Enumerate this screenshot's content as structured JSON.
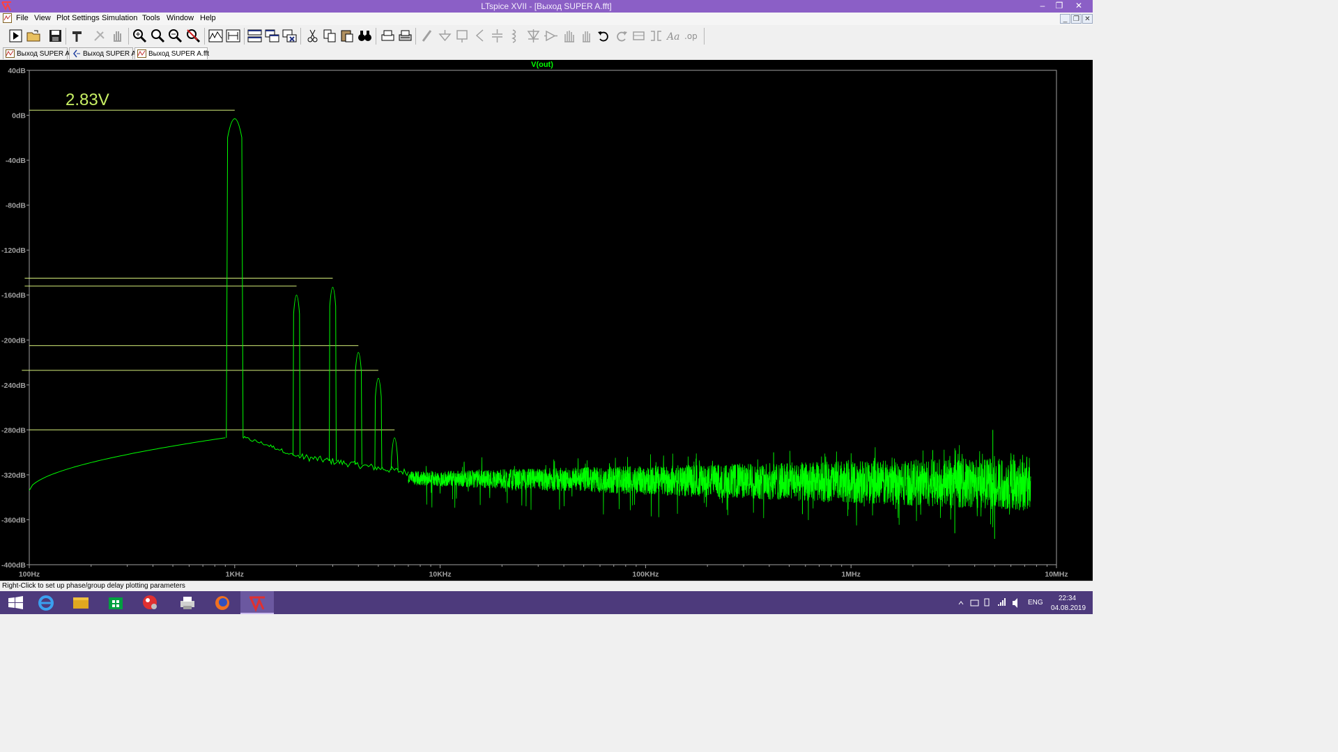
{
  "window": {
    "title": "LTspice XVII - [Выход SUPER A.fft]"
  },
  "menu": [
    "File",
    "View",
    "Plot Settings",
    "Simulation",
    "Tools",
    "Window",
    "Help"
  ],
  "toolbar_icons": [
    "run-icon",
    "open-icon",
    "save-icon",
    "hammer-icon",
    "probe-icon",
    "pan-hand-icon",
    "zoom-in-icon",
    "zoom-area-icon",
    "zoom-out-icon",
    "zoom-cancel-icon",
    "tile-plots-icon",
    "fit-plot-icon",
    "tile-horizontal-icon",
    "cascade-icon",
    "close-all-icon",
    "cut-icon",
    "copy-icon",
    "paste-icon",
    "find-icon",
    "print-icon",
    "print-setup-icon",
    "wire-icon",
    "ground-icon",
    "label-icon",
    "resistor-icon",
    "capacitor-icon",
    "inductor-icon",
    "diode-icon",
    "component-icon",
    "move-icon",
    "drag-icon",
    "undo-icon",
    "redo-icon",
    "rotate-icon",
    "mirror-icon",
    "text-icon",
    "spice-directive-icon"
  ],
  "tabs": [
    {
      "label": "Выход SUPER A",
      "icon": "waveform-icon",
      "active": false
    },
    {
      "label": "Выход SUPER A",
      "icon": "schematic-icon",
      "active": false
    },
    {
      "label": "Выход SUPER A.fft",
      "icon": "waveform-icon",
      "active": true
    }
  ],
  "chart_data": {
    "type": "line",
    "title": "V(out)",
    "annotation": "2.83V",
    "x_scale": "log",
    "xlim": [
      100,
      10000000
    ],
    "ylim": [
      -400,
      40
    ],
    "xticks": [
      {
        "value": 100,
        "label": "100Hz"
      },
      {
        "value": 1000,
        "label": "1KHz"
      },
      {
        "value": 10000,
        "label": "10KHz"
      },
      {
        "value": 100000,
        "label": "100KHz"
      },
      {
        "value": 1000000,
        "label": "1MHz"
      },
      {
        "value": 10000000,
        "label": "10MHz"
      }
    ],
    "yticks": [
      {
        "value": 40,
        "label": "40dB"
      },
      {
        "value": 0,
        "label": "0dB"
      },
      {
        "value": -40,
        "label": "-40dB"
      },
      {
        "value": -80,
        "label": "-80dB"
      },
      {
        "value": -120,
        "label": "-120dB"
      },
      {
        "value": -160,
        "label": "-160dB"
      },
      {
        "value": -200,
        "label": "-200dB"
      },
      {
        "value": -240,
        "label": "-240dB"
      },
      {
        "value": -280,
        "label": "-280dB"
      },
      {
        "value": -320,
        "label": "-320dB"
      },
      {
        "value": -360,
        "label": "-360dB"
      },
      {
        "value": -400,
        "label": "-400dB"
      }
    ],
    "harmonics": [
      {
        "freq": 1000,
        "db": 5
      },
      {
        "freq": 2000,
        "db": -152
      },
      {
        "freq": 3000,
        "db": -145
      },
      {
        "freq": 4000,
        "db": -203
      },
      {
        "freq": 5000,
        "db": -226
      },
      {
        "freq": 6000,
        "db": -279
      }
    ],
    "marker_lines": [
      {
        "db": 4.5,
        "x_from": 100,
        "x_to": 1000
      },
      {
        "db": -145,
        "x_from": 95,
        "x_to": 3000
      },
      {
        "db": -152,
        "x_from": 95,
        "x_to": 2000
      },
      {
        "db": -205,
        "x_from": 100,
        "x_to": 4000
      },
      {
        "db": -227,
        "x_from": 92,
        "x_to": 5000
      },
      {
        "db": -280,
        "x_from": 100,
        "x_to": 6000
      }
    ],
    "floor": {
      "start": [
        100,
        -334
      ],
      "near_fundamental": [
        900,
        -287
      ],
      "after_fundamental": [
        1100,
        -287
      ],
      "at_2k": [
        1950,
        -303
      ],
      "at_10k": [
        10000,
        -322
      ],
      "at_100k": [
        100000,
        -327
      ],
      "at_1M": [
        1000000,
        -329
      ],
      "end_freq": 7500000,
      "end_db": -320
    },
    "line_color": "#00ff00",
    "grid": false,
    "legend": "none"
  },
  "status": "Right-Click to set up phase/group delay plotting parameters",
  "taskbar": {
    "apps": [
      "windows-start-icon",
      "internet-explorer-icon",
      "file-explorer-icon",
      "store-icon",
      "paint-app-icon",
      "printer-app-icon",
      "firefox-icon",
      "ltspice-icon"
    ],
    "lang": "ENG",
    "time": "22:34",
    "date": "04.08.2019"
  }
}
